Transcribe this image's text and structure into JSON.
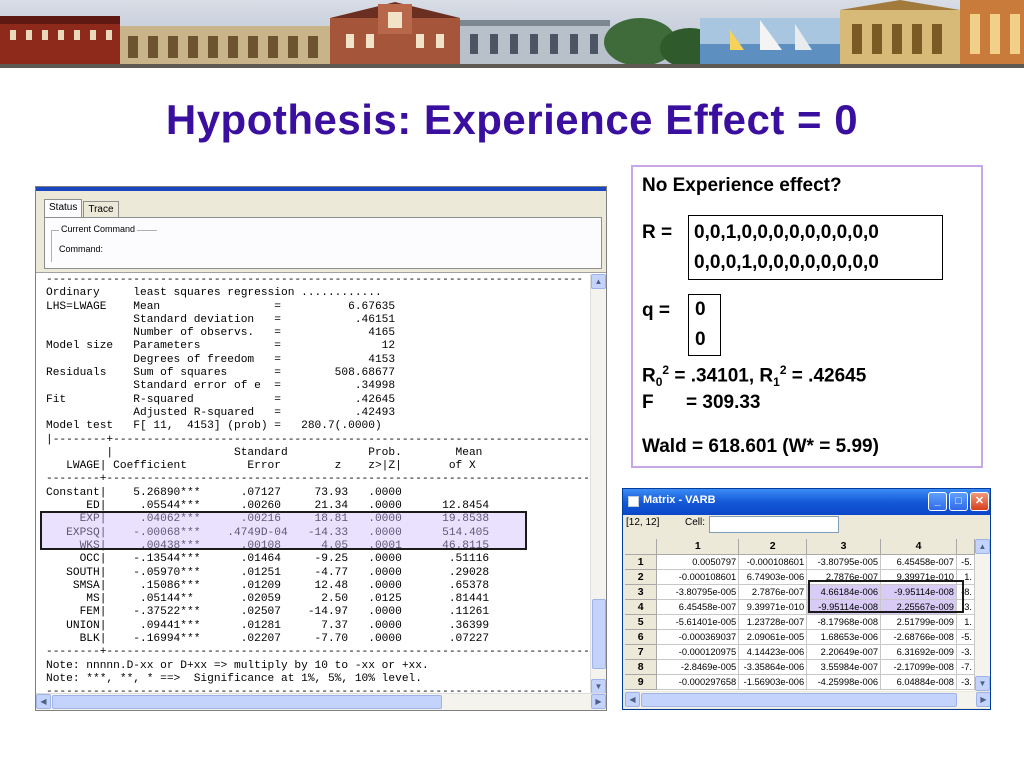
{
  "slide": {
    "title": "Hypothesis: Experience Effect = 0"
  },
  "output_window": {
    "tabs": [
      "Status",
      "Trace"
    ],
    "group_label": "Current Command",
    "command_label": "Command:",
    "lines": [
      "--------------------------------------------------------------------------------",
      "Ordinary     least squares regression ............",
      "LHS=LWAGE    Mean                 =          6.67635",
      "             Standard deviation   =           .46151",
      "             Number of observs.   =             4165",
      "Model size   Parameters           =               12",
      "             Degrees of freedom   =             4153",
      "Residuals    Sum of squares       =        508.68677",
      "             Standard error of e  =           .34998",
      "Fit          R-squared            =           .42645",
      "             Adjusted R-squared   =           .42493",
      "Model test   F[ 11,  4153] (prob) =   280.7(.0000)",
      "|--------+------------------------------------------------------------------------",
      "         |                  Standard            Prob.        Mean",
      "   LWAGE| Coefficient         Error        z    z>|Z|       of X",
      "--------+------------------------------------------------------------------------",
      "Constant|    5.26890***      .07127     73.93   .0000",
      "      ED|     .05544***      .00260     21.34   .0000      12.8454",
      "     EXP|     .04062***      .00216     18.81   .0000      19.8538",
      "   EXPSQ|    -.00068***    .4749D-04   -14.33   .0000      514.405",
      "     WKS|     .00438***      .00108      4.05   .0001      46.8115",
      "     OCC|    -.13544***      .01464     -9.25   .0000       .51116",
      "   SOUTH|    -.05970***      .01251     -4.77   .0000       .29028",
      "    SMSA|     .15086***      .01209     12.48   .0000       .65378",
      "      MS|     .05144**       .02059      2.50   .0125       .81441",
      "     FEM|    -.37522***      .02507    -14.97   .0000       .11261",
      "   UNION|     .09441***      .01281      7.37   .0000       .36399",
      "     BLK|    -.16994***      .02207     -7.70   .0000       .07227",
      "--------+------------------------------------------------------------------------",
      "Note: nnnnn.D-xx or D+xx => multiply by 10 to -xx or +xx.",
      "Note: ***, **, * ==>  Significance at 1%, 5%, 10% level.",
      "--------------------------------------------------------------------------------"
    ]
  },
  "info_box": {
    "heading": "No Experience effect?",
    "r_label": "R =",
    "r_row1": "0,0,1,0,0,0,0,0,0,0,0,0",
    "r_row2": "0,0,0,1,0,0,0,0,0,0,0,0",
    "q_label": "q =",
    "q_row1": "0",
    "q_row2": "0",
    "r0_sym": "R",
    "r0_sub": "0",
    "r0_sup": "2",
    "r0_val": " = .34101, R",
    "r1_sub": "1",
    "r1_sup": "2",
    "r1_val": " = .42645",
    "f_label": "F",
    "f_val": "= 309.33",
    "wald": "Wald = 618.601 (W* = 5.99)"
  },
  "matrix_window": {
    "title": "Matrix - VARB",
    "cell_ref": "[12, 12]",
    "cell_label": "Cell:",
    "col_headers": [
      "",
      "1",
      "2",
      "3",
      "4",
      ""
    ],
    "rows": [
      {
        "h": "1",
        "c": [
          "0.0050797",
          "-0.000108601",
          "-3.80795e-005",
          "6.45458e-007",
          "-5."
        ]
      },
      {
        "h": "2",
        "c": [
          "-0.000108601",
          "6.74903e-006",
          "2.7876e-007",
          "9.39971e-010",
          "1."
        ]
      },
      {
        "h": "3",
        "c": [
          "-3.80795e-005",
          "2.7876e-007",
          "4.66184e-006",
          "-9.95114e-008",
          "-8."
        ]
      },
      {
        "h": "4",
        "c": [
          "6.45458e-007",
          "9.39971e-010",
          "-9.95114e-008",
          "2.25567e-009",
          "3."
        ]
      },
      {
        "h": "5",
        "c": [
          "-5.61401e-005",
          "1.23728e-007",
          "-8.17968e-008",
          "2.51799e-009",
          "1."
        ]
      },
      {
        "h": "6",
        "c": [
          "-0.000369037",
          "2.09061e-005",
          "1.68653e-006",
          "-2.68766e-008",
          "-5."
        ]
      },
      {
        "h": "7",
        "c": [
          "-0.000120975",
          "4.14423e-006",
          "2.20649e-007",
          "6.31692e-009",
          "-3."
        ]
      },
      {
        "h": "8",
        "c": [
          "-2.8469e-005",
          "-3.35864e-006",
          "3.55984e-007",
          "-2.17099e-008",
          "-7."
        ]
      },
      {
        "h": "9",
        "c": [
          "-0.000297658",
          "-1.56903e-006",
          "-4.25998e-006",
          "6.04884e-008",
          "-3."
        ]
      }
    ]
  },
  "colors": {
    "title": "#3a0e9e",
    "highlight": "#ceBcfa",
    "infobox_border": "#c9a7e7",
    "titlebar": "#1559d8"
  }
}
